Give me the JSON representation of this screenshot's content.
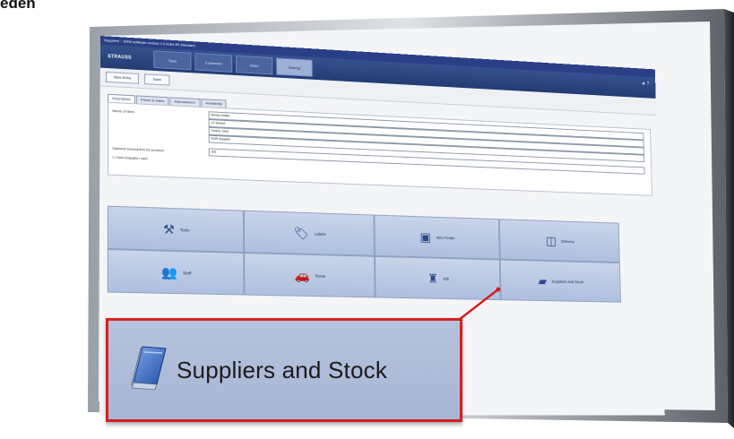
{
  "heading": "eden",
  "app": {
    "window_title": "Suppliers ~ ERM software version 1.0 build 4R Standard",
    "logo": "STRAUSS",
    "topnav": [
      "Tools",
      "Customers",
      "Sales",
      "Settings"
    ],
    "topnav_active": 3,
    "topbar_right": "◄ ?",
    "toolbar": {
      "new_label": "New Entry",
      "save_label": "Save"
    },
    "tabs": [
      "Description",
      "Prices & Sales",
      "Manufacturer",
      "Availability"
    ],
    "form": {
      "name_label": "Name of item",
      "fields": [
        "Bonus Grade",
        "LF Sensor",
        "Freeze Joint",
        "EGR Supplier"
      ],
      "second_label": "Optional Description for product",
      "second_value": "001",
      "checkbox_label": "Hold Dispatch card"
    },
    "tiles": [
      [
        {
          "label": "Tools",
          "icon": "tools-icon"
        },
        {
          "label": "Labels",
          "icon": "label-icon"
        },
        {
          "label": "Item Finder",
          "icon": "finder-icon"
        },
        {
          "label": "Delivery",
          "icon": "delivery-icon"
        }
      ],
      [
        {
          "label": "Staff",
          "icon": "people-icon"
        },
        {
          "label": "Route",
          "icon": "car-icon"
        },
        {
          "label": "Gift",
          "icon": "bottle-icon"
        },
        {
          "label": "Suppliers and Stock",
          "icon": "suppliers-icon"
        }
      ]
    ]
  },
  "callout": {
    "label": "Suppliers and Stock",
    "icon": "suppliers-stock-icon",
    "border_color": "#d4201f"
  }
}
